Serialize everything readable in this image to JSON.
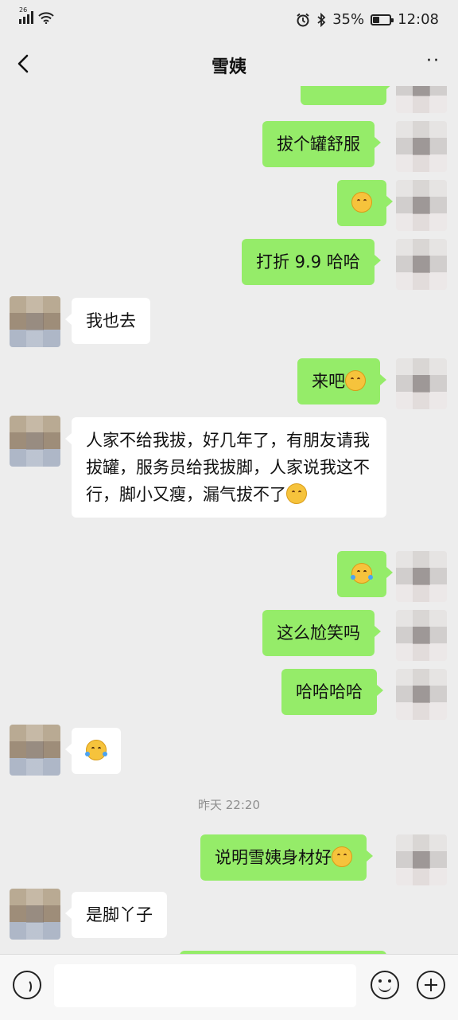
{
  "status_bar": {
    "network": "26",
    "battery": "35%",
    "battery_level_percent": 35,
    "time": "12:08",
    "icons": [
      "signal-icon",
      "wifi-icon",
      "alarm-icon",
      "bluetooth-icon",
      "battery-icon"
    ]
  },
  "nav": {
    "title": "雪姨",
    "back_icon": "chevron-left-icon",
    "more_icon": "more-dots-icon"
  },
  "messages": [
    {
      "side": "out",
      "text": "拔个罐舒服",
      "emoji": ""
    },
    {
      "side": "out",
      "text": "",
      "emoji": "blush"
    },
    {
      "side": "out",
      "text": "打折 9.9 哈哈",
      "emoji": ""
    },
    {
      "side": "in",
      "text": "我也去",
      "emoji": ""
    },
    {
      "side": "out",
      "text": "来吧",
      "emoji": "blush"
    },
    {
      "side": "in",
      "text": "人家不给我拔，好几年了，有朋友请我拔罐，服务员给我拔脚，人家说我这不行，脚小又瘦，漏气拔不了",
      "emoji": "blush"
    },
    {
      "side": "out",
      "text": "",
      "emoji": "laugh-cry"
    },
    {
      "side": "out",
      "text": "这么尬笑吗",
      "emoji": ""
    },
    {
      "side": "out",
      "text": "哈哈哈哈",
      "emoji": ""
    },
    {
      "side": "in",
      "text": "",
      "emoji": "laugh-cry"
    },
    {
      "side": "out",
      "text": "说明雪姨身材好",
      "emoji": "blush"
    },
    {
      "side": "in",
      "text": "是脚丫子",
      "emoji": ""
    }
  ],
  "timestamp": "昨天 22:20",
  "input_bar": {
    "placeholder": "",
    "icons": [
      "voice-icon",
      "emoji-icon",
      "plus-icon"
    ]
  }
}
